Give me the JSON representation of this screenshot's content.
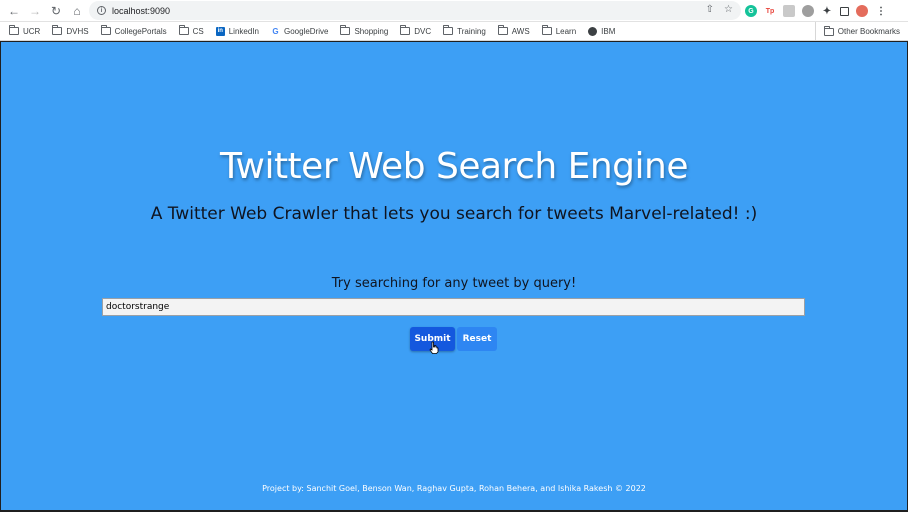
{
  "browser": {
    "url": "localhost:9090",
    "bookmarks": [
      {
        "label": "UCR",
        "icon": "folder-icon"
      },
      {
        "label": "DVHS",
        "icon": "folder-icon"
      },
      {
        "label": "CollegePortals",
        "icon": "folder-icon"
      },
      {
        "label": "CS",
        "icon": "folder-icon"
      },
      {
        "label": "LinkedIn",
        "icon": "linkedin-icon"
      },
      {
        "label": "GoogleDrive",
        "icon": "google-icon"
      },
      {
        "label": "Shopping",
        "icon": "folder-icon"
      },
      {
        "label": "DVC",
        "icon": "folder-icon"
      },
      {
        "label": "Training",
        "icon": "folder-icon"
      },
      {
        "label": "AWS",
        "icon": "folder-icon"
      },
      {
        "label": "Learn",
        "icon": "folder-icon"
      },
      {
        "label": "IBM",
        "icon": "globe-icon"
      }
    ],
    "other_bookmarks": "Other Bookmarks",
    "extension_colors": {
      "grammarly": "#15c39a",
      "tp": "#e8453c",
      "avatar": "#e46c5c"
    }
  },
  "page": {
    "background_color": "#3d9ff5",
    "title": "Twitter Web Search Engine",
    "subtitle": "A Twitter Web Crawler that lets you search for tweets Marvel-related! :)",
    "prompt": "Try searching for any tweet by query!",
    "search_value": "doctorstrange",
    "submit_label": "Submit",
    "reset_label": "Reset",
    "footer": "Project by: Sanchit Goel, Benson Wan, Raghav Gupta, Rohan Behera, and Ishika Rakesh © 2022"
  }
}
